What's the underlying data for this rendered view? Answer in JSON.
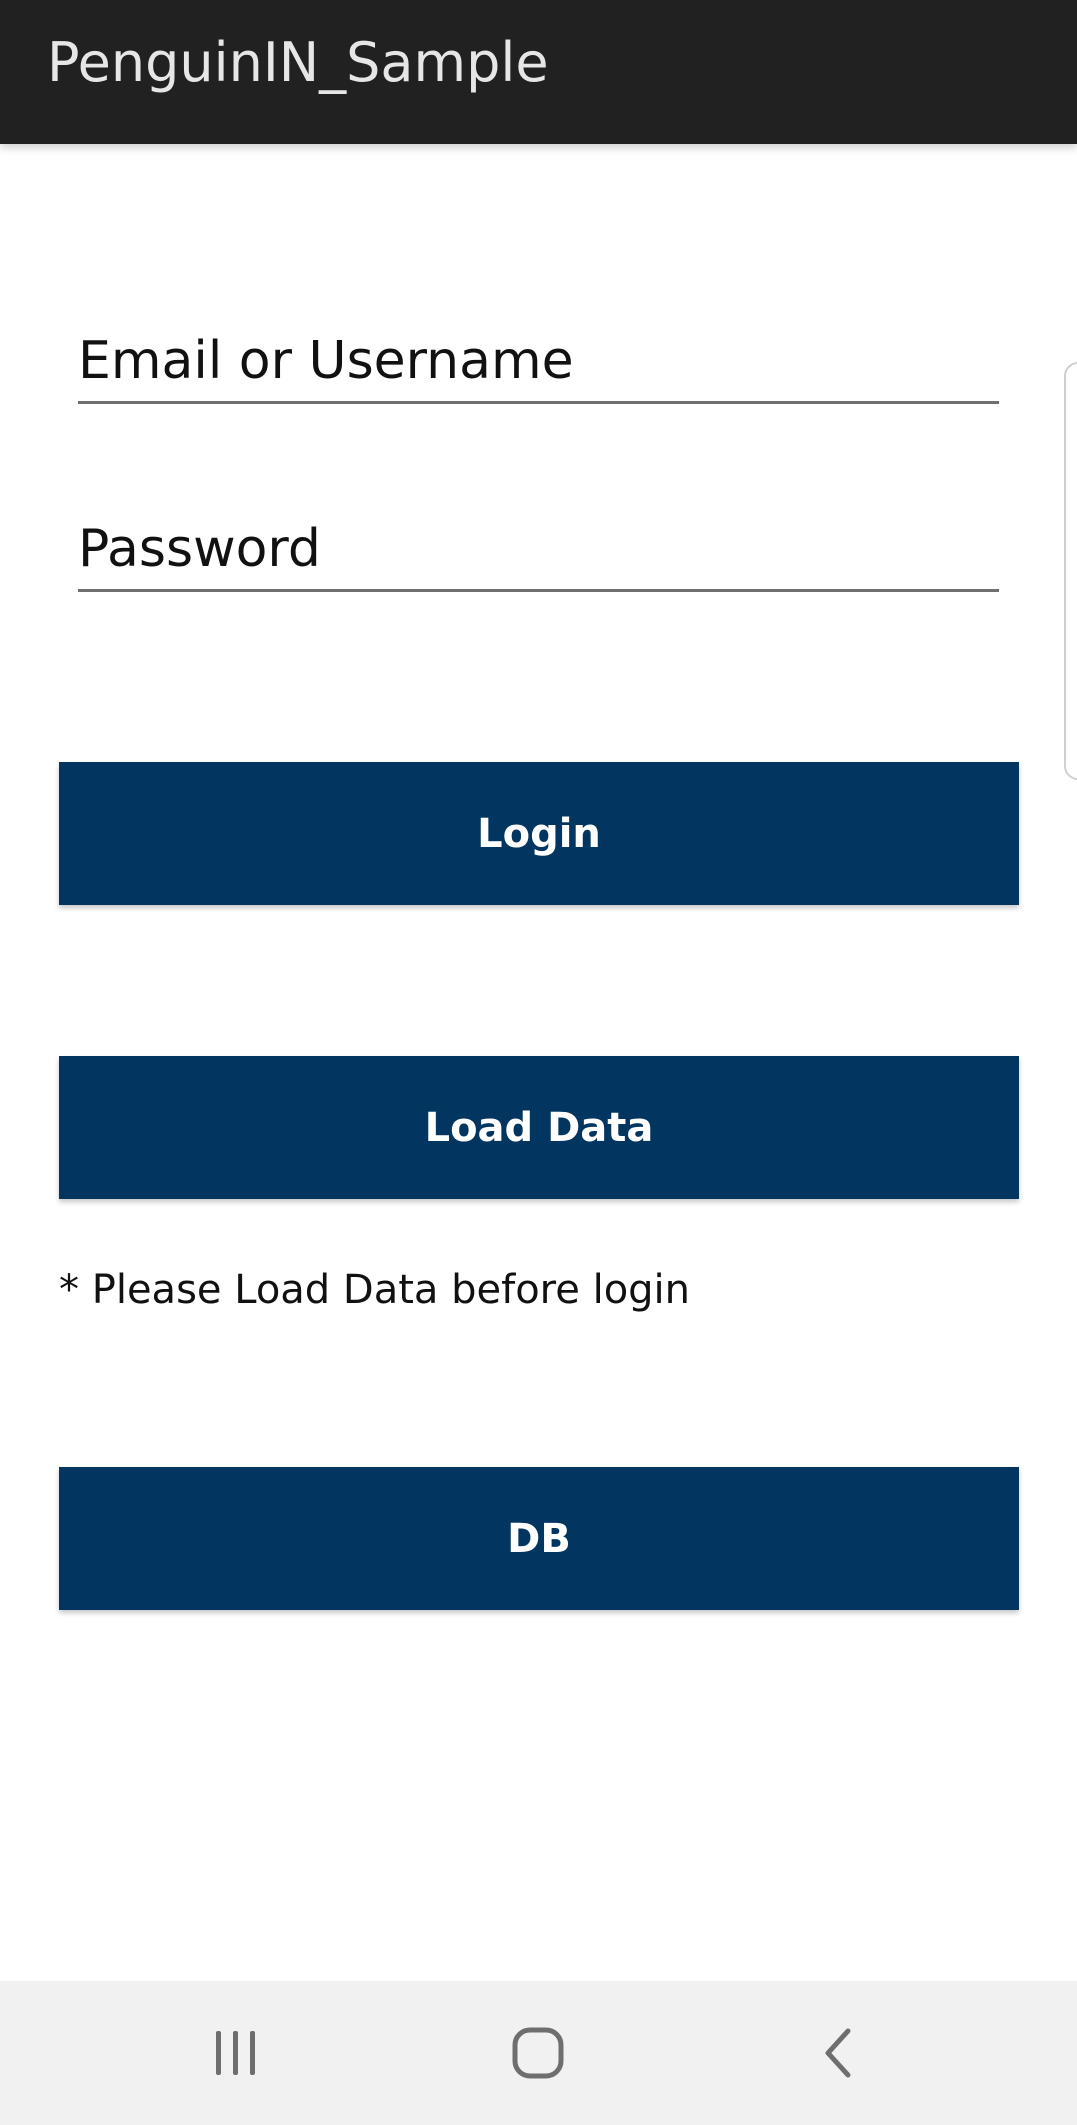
{
  "app_bar": {
    "title": "PenguinIN_Sample"
  },
  "form": {
    "email_placeholder": "Email or Username",
    "password_placeholder": "Password"
  },
  "buttons": {
    "login_label": "Login",
    "load_data_label": "Load Data",
    "db_label": "DB"
  },
  "hint_text": "* Please Load Data before login",
  "colors": {
    "app_bar": "#212121",
    "button": "#02355f",
    "nav_bar": "#f1f1f1"
  },
  "nav": {
    "icons": [
      "recent-apps-icon",
      "home-icon",
      "back-icon"
    ]
  }
}
